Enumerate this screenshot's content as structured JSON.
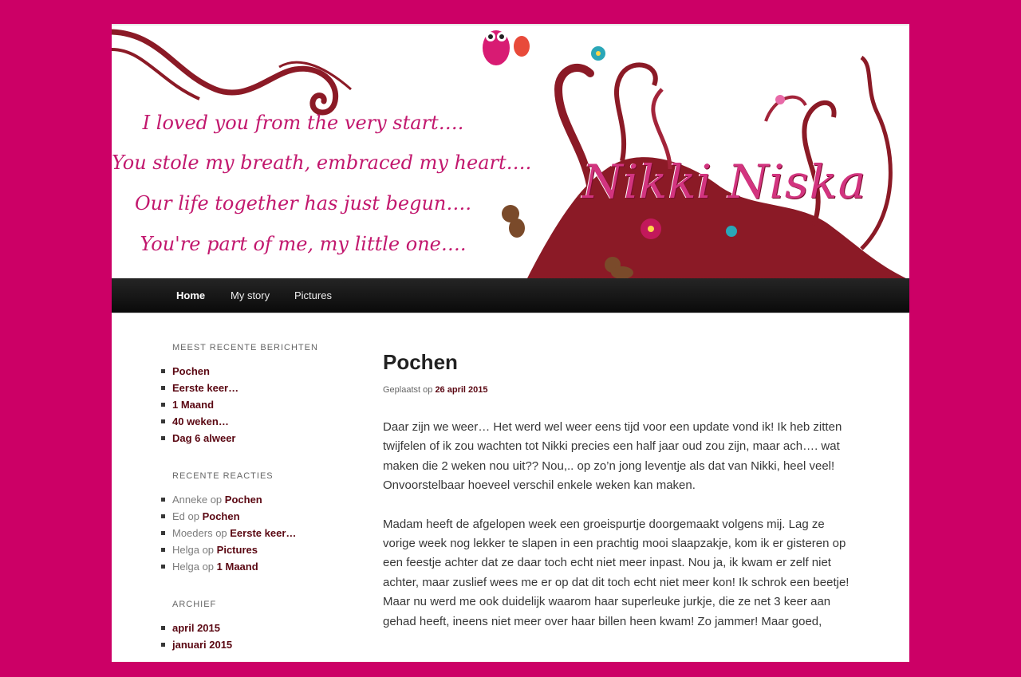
{
  "banner": {
    "quote_lines": [
      "I loved you from the very start….",
      "You stole my breath, embraced my heart….",
      "Our life together has just begun….",
      "You're part of me, my little one…."
    ],
    "brand": "Nikki Niska"
  },
  "nav": {
    "items": [
      {
        "label": "Home",
        "current": true
      },
      {
        "label": "My story",
        "current": false
      },
      {
        "label": "Pictures",
        "current": false
      }
    ]
  },
  "sidebar": {
    "recent_posts": {
      "title": "MEEST RECENTE BERICHTEN",
      "items": [
        "Pochen",
        "Eerste keer…",
        "1 Maand",
        "40 weken…",
        "Dag 6 alweer"
      ]
    },
    "recent_comments": {
      "title": "RECENTE REACTIES",
      "items": [
        {
          "author": "Anneke",
          "sep": " op ",
          "post": "Pochen"
        },
        {
          "author": "Ed",
          "sep": " op ",
          "post": "Pochen"
        },
        {
          "author": "Moeders",
          "sep": " op ",
          "post": "Eerste keer…"
        },
        {
          "author": "Helga",
          "sep": " op ",
          "post": "Pictures"
        },
        {
          "author": "Helga",
          "sep": " op ",
          "post": "1 Maand"
        }
      ]
    },
    "archive": {
      "title": "ARCHIEF",
      "items": [
        "april 2015",
        "januari 2015"
      ]
    }
  },
  "post": {
    "title": "Pochen",
    "meta_prefix": "Geplaatst op ",
    "date": "26 april 2015",
    "paragraphs": [
      "Daar zijn we weer… Het werd wel weer eens tijd voor een update vond ik! Ik heb zitten twijfelen of ik zou wachten tot Nikki precies een half jaar oud zou zijn, maar ach…. wat maken die 2 weken nou uit?? Nou,.. op zo’n jong leventje als dat van Nikki, heel veel! Onvoorstelbaar hoeveel verschil enkele weken kan maken.",
      "Madam heeft de afgelopen week een groeispurtje doorgemaakt volgens mij. Lag ze vorige week nog lekker te slapen in een prachtig mooi slaapzakje, kom ik er gisteren op een feestje achter dat ze daar toch echt niet meer inpast. Nou ja, ik kwam er zelf niet achter, maar zuslief wees me er op dat dit toch echt niet meer kon! Ik schrok een beetje! Maar nu werd me ook duidelijk waarom haar superleuke jurkje, die ze net 3 keer aan gehad heeft, ineens niet meer over haar billen heen kwam! Zo jammer! Maar goed,"
    ]
  },
  "colors": {
    "background": "#cc0066",
    "link": "#5a0712",
    "banner_text": "#c2186e",
    "tree": "#8b1a26"
  }
}
